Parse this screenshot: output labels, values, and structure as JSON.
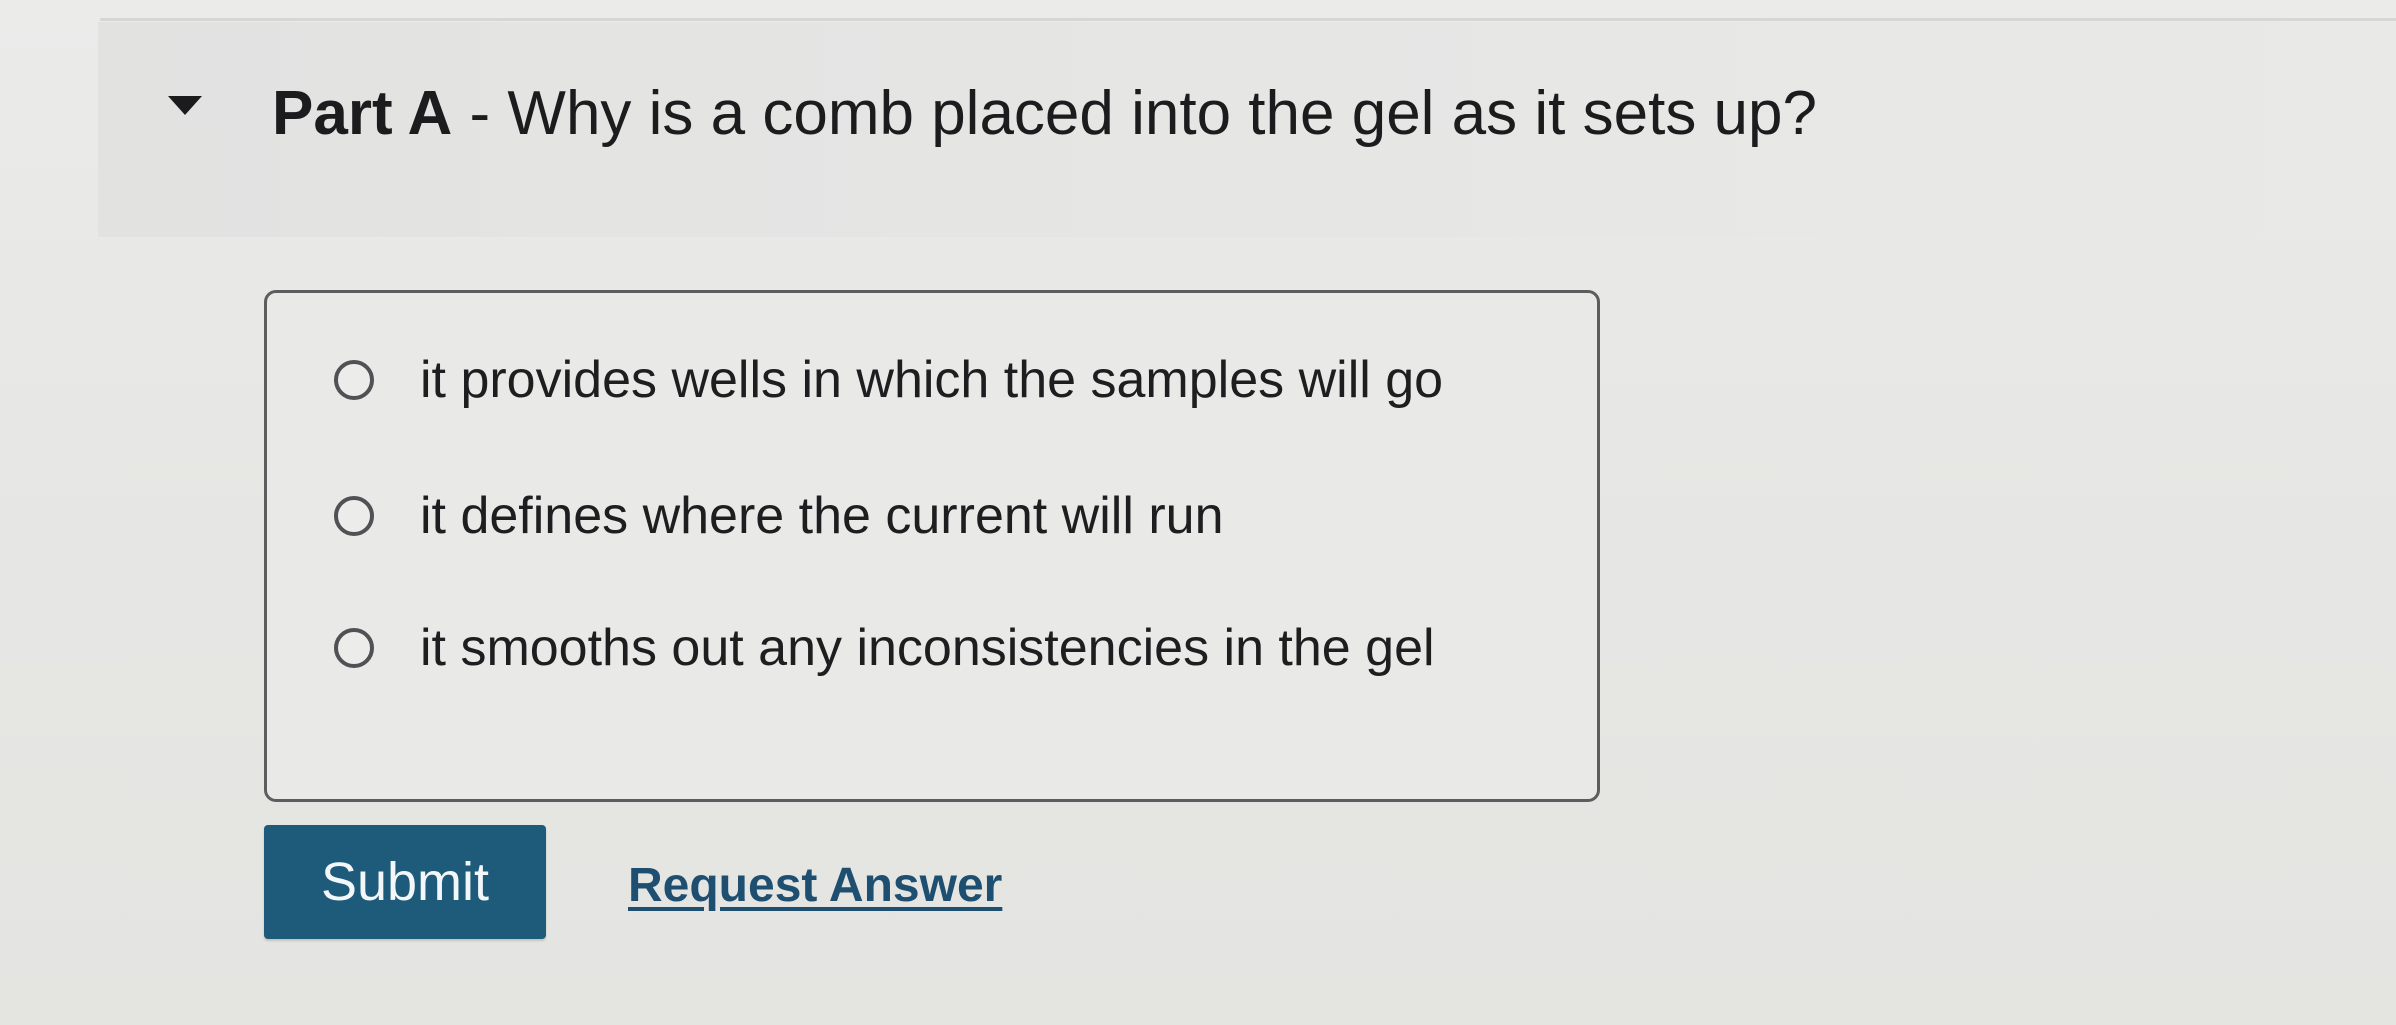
{
  "part": {
    "label": "Part A",
    "separator": " - ",
    "question": "Why is a comb placed into the gel as it sets up?"
  },
  "options": [
    {
      "text": "it provides wells in which the samples will go",
      "selected": false
    },
    {
      "text": "it defines where the current will run",
      "selected": false
    },
    {
      "text": "it smooths out any inconsistencies in the gel",
      "selected": false
    }
  ],
  "actions": {
    "submit_label": "Submit",
    "request_answer_label": "Request Answer"
  },
  "colors": {
    "submit_bg": "#1e5b7a",
    "link": "#1f4f70"
  },
  "icons": {
    "toggle": "caret-down-icon",
    "option": "radio-unselected-icon"
  }
}
